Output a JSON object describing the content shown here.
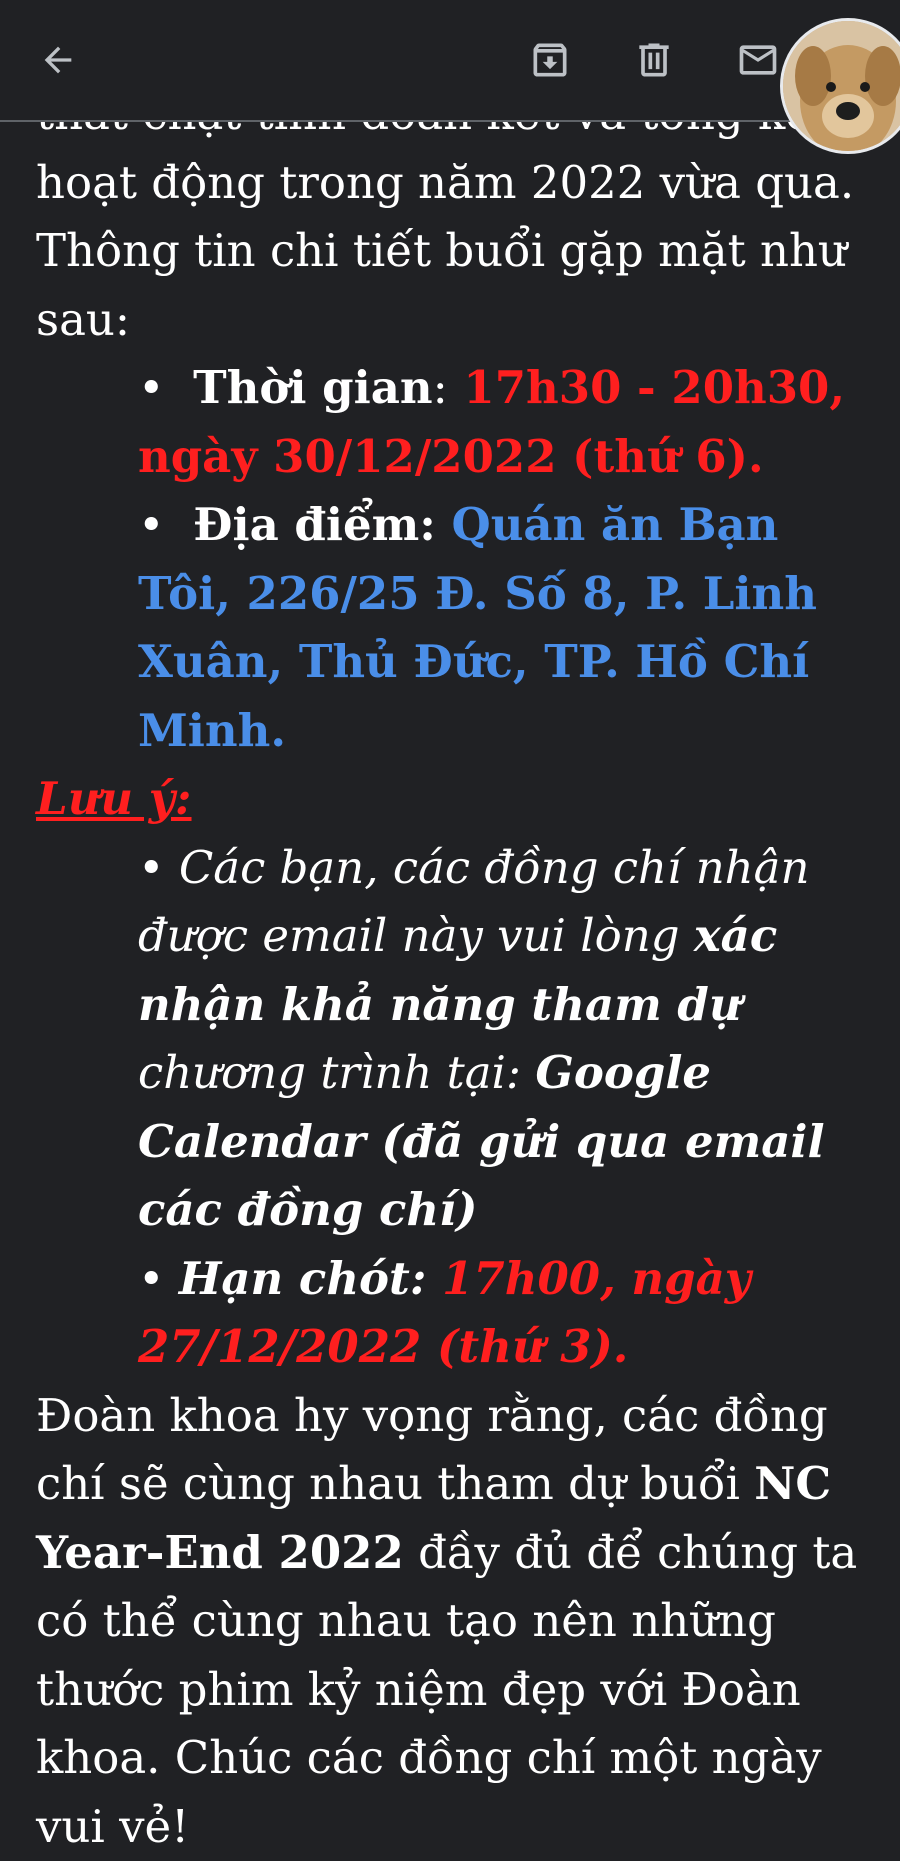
{
  "toolbar": {
    "back_icon": "arrow-left-icon",
    "archive_icon": "archive-icon",
    "delete_icon": "trash-icon",
    "mail_icon": "mail-icon",
    "avatar_icon": "dog-avatar"
  },
  "colors": {
    "background": "#202124",
    "text": "#ffffff",
    "red": "#ff1f1f",
    "blue": "#4a8ee8"
  },
  "email": {
    "clipped_line": "thắt chặt tinh đoàn kết và tổng kết",
    "intro": "hoạt động trong năm 2022 vừa qua. Thông tin chi tiết buổi gặp mặt như sau:",
    "time_label": "Thời gian",
    "time_colon": ":",
    "time_value": " 17h30 - 20h30, ngày 30/12/2022 (thứ 6).",
    "place_label": "Địa điểm:",
    "place_value": "  Quán ăn Bạn Tôi, 226/25 Đ. Số 8, P. Linh Xuân, Thủ Đức, TP. Hồ Chí Minh.",
    "note_label": "Lưu ý:",
    "note1_a": "Các bạn, các đồng chí nhận được email này vui lòng ",
    "note1_b": "xác nhận khả năng tham dự",
    "note1_c": " chương trình tại: ",
    "note1_d": "Google Calendar (đã gửi qua email các đồng chí)",
    "deadline_label": "Hạn chót:",
    "deadline_value": " 17h00, ngày 27/12/2022 (thứ 3).",
    "closing_a": "Đoàn khoa hy vọng rằng, các đồng chí sẽ cùng nhau tham dự buổi ",
    "closing_b": "NC Year-End 2022",
    "closing_c": " đầy đủ để chúng ta có thể cùng nhau tạo nên những thước phim kỷ niệm đẹp với Đoàn khoa. Chúc các đồng chí một ngày vui vẻ!"
  }
}
